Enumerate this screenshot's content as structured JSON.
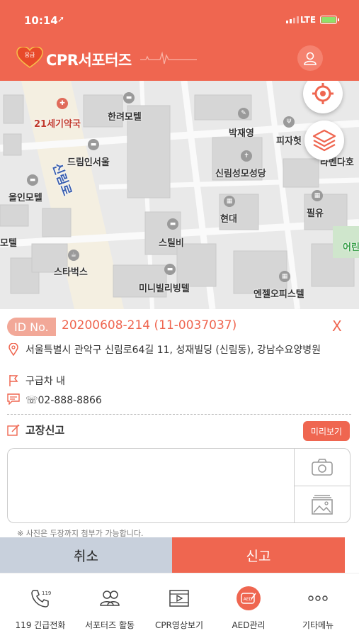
{
  "status": {
    "time": "10:14",
    "network": "LTE"
  },
  "header": {
    "logo_text": "응급",
    "title": "CPR서포터즈"
  },
  "map": {
    "labels": {
      "l1": "21세기약국",
      "l2": "한려모텔",
      "l3": "박재영",
      "l4": "피자헛",
      "l5": "드림인서울",
      "l6": "신림성모성당",
      "l7": "라벤다호",
      "l8": "올인모텔",
      "l9": "현대",
      "l10": "필유",
      "l11": "스틸비",
      "l12": "스타벅스",
      "l13": "미니빌리빙텔",
      "l14": "엔젤오피스텔",
      "l15": "모텔",
      "l16": "어린",
      "road": "신림로"
    }
  },
  "info": {
    "id_label": "ID No.",
    "id_value": "20200608-214 (11-0037037)",
    "close": "X",
    "address": "서울특별시 관악구 신림로64길 11, 성재빌딩 (신림동), 강남수요양병원",
    "location": "구급차 내",
    "phone": "☏02-888-8866"
  },
  "report": {
    "title": "고장신고",
    "preview": "미리보기",
    "note": "※ 사진은 두장까지 첨부가 가능합니다.",
    "placeholder": ""
  },
  "actions": {
    "cancel": "취소",
    "submit": "신고"
  },
  "tabs": [
    {
      "label": "119 긴급전화",
      "icon": "phone-119-icon"
    },
    {
      "label": "서포터즈 활동",
      "icon": "people-icon"
    },
    {
      "label": "CPR영상보기",
      "icon": "video-icon"
    },
    {
      "label": "AED관리",
      "icon": "aed-icon"
    },
    {
      "label": "기타메뉴",
      "icon": "more-icon"
    }
  ],
  "colors": {
    "primary": "#ef6650",
    "id_badge": "#f2a898",
    "cancel_bg": "#c8d0dc"
  }
}
